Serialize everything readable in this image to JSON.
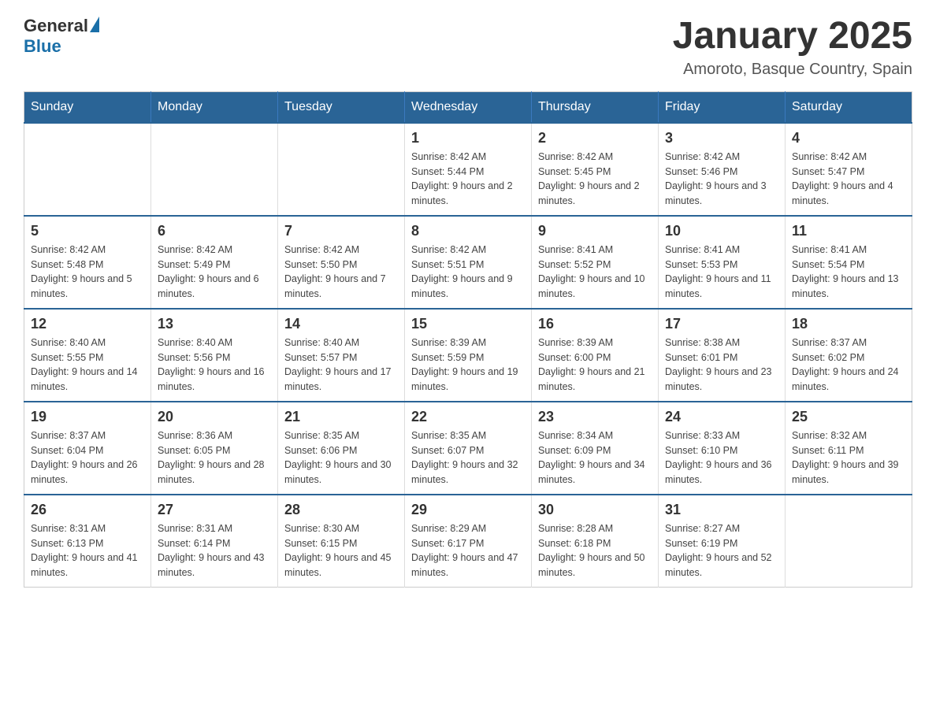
{
  "logo": {
    "general": "General",
    "blue": "Blue"
  },
  "title": "January 2025",
  "subtitle": "Amoroto, Basque Country, Spain",
  "days_of_week": [
    "Sunday",
    "Monday",
    "Tuesday",
    "Wednesday",
    "Thursday",
    "Friday",
    "Saturday"
  ],
  "weeks": [
    [
      {
        "day": "",
        "info": ""
      },
      {
        "day": "",
        "info": ""
      },
      {
        "day": "",
        "info": ""
      },
      {
        "day": "1",
        "info": "Sunrise: 8:42 AM\nSunset: 5:44 PM\nDaylight: 9 hours and 2 minutes."
      },
      {
        "day": "2",
        "info": "Sunrise: 8:42 AM\nSunset: 5:45 PM\nDaylight: 9 hours and 2 minutes."
      },
      {
        "day": "3",
        "info": "Sunrise: 8:42 AM\nSunset: 5:46 PM\nDaylight: 9 hours and 3 minutes."
      },
      {
        "day": "4",
        "info": "Sunrise: 8:42 AM\nSunset: 5:47 PM\nDaylight: 9 hours and 4 minutes."
      }
    ],
    [
      {
        "day": "5",
        "info": "Sunrise: 8:42 AM\nSunset: 5:48 PM\nDaylight: 9 hours and 5 minutes."
      },
      {
        "day": "6",
        "info": "Sunrise: 8:42 AM\nSunset: 5:49 PM\nDaylight: 9 hours and 6 minutes."
      },
      {
        "day": "7",
        "info": "Sunrise: 8:42 AM\nSunset: 5:50 PM\nDaylight: 9 hours and 7 minutes."
      },
      {
        "day": "8",
        "info": "Sunrise: 8:42 AM\nSunset: 5:51 PM\nDaylight: 9 hours and 9 minutes."
      },
      {
        "day": "9",
        "info": "Sunrise: 8:41 AM\nSunset: 5:52 PM\nDaylight: 9 hours and 10 minutes."
      },
      {
        "day": "10",
        "info": "Sunrise: 8:41 AM\nSunset: 5:53 PM\nDaylight: 9 hours and 11 minutes."
      },
      {
        "day": "11",
        "info": "Sunrise: 8:41 AM\nSunset: 5:54 PM\nDaylight: 9 hours and 13 minutes."
      }
    ],
    [
      {
        "day": "12",
        "info": "Sunrise: 8:40 AM\nSunset: 5:55 PM\nDaylight: 9 hours and 14 minutes."
      },
      {
        "day": "13",
        "info": "Sunrise: 8:40 AM\nSunset: 5:56 PM\nDaylight: 9 hours and 16 minutes."
      },
      {
        "day": "14",
        "info": "Sunrise: 8:40 AM\nSunset: 5:57 PM\nDaylight: 9 hours and 17 minutes."
      },
      {
        "day": "15",
        "info": "Sunrise: 8:39 AM\nSunset: 5:59 PM\nDaylight: 9 hours and 19 minutes."
      },
      {
        "day": "16",
        "info": "Sunrise: 8:39 AM\nSunset: 6:00 PM\nDaylight: 9 hours and 21 minutes."
      },
      {
        "day": "17",
        "info": "Sunrise: 8:38 AM\nSunset: 6:01 PM\nDaylight: 9 hours and 23 minutes."
      },
      {
        "day": "18",
        "info": "Sunrise: 8:37 AM\nSunset: 6:02 PM\nDaylight: 9 hours and 24 minutes."
      }
    ],
    [
      {
        "day": "19",
        "info": "Sunrise: 8:37 AM\nSunset: 6:04 PM\nDaylight: 9 hours and 26 minutes."
      },
      {
        "day": "20",
        "info": "Sunrise: 8:36 AM\nSunset: 6:05 PM\nDaylight: 9 hours and 28 minutes."
      },
      {
        "day": "21",
        "info": "Sunrise: 8:35 AM\nSunset: 6:06 PM\nDaylight: 9 hours and 30 minutes."
      },
      {
        "day": "22",
        "info": "Sunrise: 8:35 AM\nSunset: 6:07 PM\nDaylight: 9 hours and 32 minutes."
      },
      {
        "day": "23",
        "info": "Sunrise: 8:34 AM\nSunset: 6:09 PM\nDaylight: 9 hours and 34 minutes."
      },
      {
        "day": "24",
        "info": "Sunrise: 8:33 AM\nSunset: 6:10 PM\nDaylight: 9 hours and 36 minutes."
      },
      {
        "day": "25",
        "info": "Sunrise: 8:32 AM\nSunset: 6:11 PM\nDaylight: 9 hours and 39 minutes."
      }
    ],
    [
      {
        "day": "26",
        "info": "Sunrise: 8:31 AM\nSunset: 6:13 PM\nDaylight: 9 hours and 41 minutes."
      },
      {
        "day": "27",
        "info": "Sunrise: 8:31 AM\nSunset: 6:14 PM\nDaylight: 9 hours and 43 minutes."
      },
      {
        "day": "28",
        "info": "Sunrise: 8:30 AM\nSunset: 6:15 PM\nDaylight: 9 hours and 45 minutes."
      },
      {
        "day": "29",
        "info": "Sunrise: 8:29 AM\nSunset: 6:17 PM\nDaylight: 9 hours and 47 minutes."
      },
      {
        "day": "30",
        "info": "Sunrise: 8:28 AM\nSunset: 6:18 PM\nDaylight: 9 hours and 50 minutes."
      },
      {
        "day": "31",
        "info": "Sunrise: 8:27 AM\nSunset: 6:19 PM\nDaylight: 9 hours and 52 minutes."
      },
      {
        "day": "",
        "info": ""
      }
    ]
  ]
}
